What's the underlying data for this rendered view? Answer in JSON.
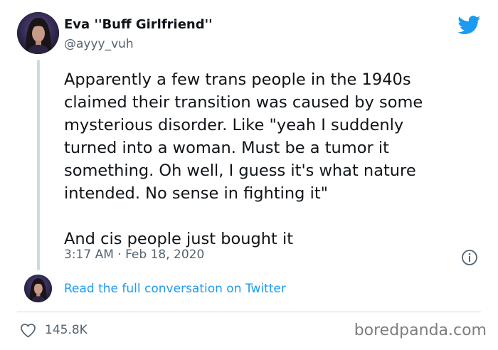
{
  "tweet": {
    "display_name": "Eva ''Buff Girlfriend''",
    "handle": "@ayyy_vuh",
    "body_lines": [
      "Apparently a few trans people in the 1940s",
      "claimed their transition was caused by some",
      "mysterious disorder. Like \"yeah I suddenly",
      "turned into a woman. Must be a tumor it",
      "something. Oh well, I guess it's what nature",
      "intended. No sense in fighting it\""
    ],
    "closing_line": "And cis people just bought it",
    "timestamp": "3:17 AM · Feb 18, 2020",
    "read_more_link": "Read the full conversation on Twitter",
    "like_count": "145.8K"
  },
  "watermark": "boredpanda.com",
  "icons": {
    "brand": "twitter-bird-icon",
    "info": "info-icon",
    "like": "heart-icon"
  },
  "colors": {
    "twitter_blue": "#1d9bf0",
    "text_primary": "#0f1419",
    "text_secondary": "#536471",
    "divider": "#cfd9de"
  }
}
